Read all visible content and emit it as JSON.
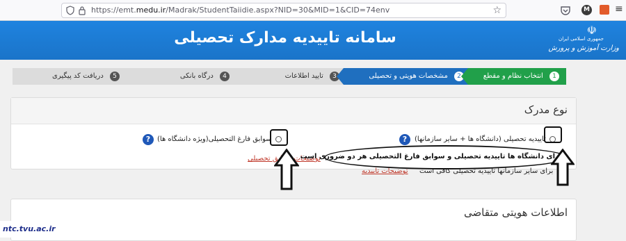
{
  "browser": {
    "url_prefix": "https://emt.",
    "url_domain": "medu.ir",
    "url_path": "/Madrak/StudentTaiidie.aspx?NID=30&MID=1&CID=74env",
    "profile_initial": "M"
  },
  "header": {
    "site_title": "سامانه تاییدیه مدارک تحصیلی",
    "logo_line1": "جمهوری اسلامی ایران",
    "logo_line2": "وزارت آموزش و پرورش",
    "color": "#1f83df"
  },
  "steps": [
    {
      "num": "1",
      "label": "انتخاب نظام و مقطع",
      "state": "done"
    },
    {
      "num": "2",
      "label": "مشخصات هویتی و تحصیلی",
      "state": "active"
    },
    {
      "num": "3",
      "label": "تایید اطلاعات",
      "state": "pending"
    },
    {
      "num": "4",
      "label": "درگاه بانکی",
      "state": "pending"
    },
    {
      "num": "5",
      "label": "دریافت کد پیگیری",
      "state": "pending"
    }
  ],
  "doc_type": {
    "title": "نوع مدرک",
    "option1": "تاییدیه تحصیلی (دانشگاه ها + سایر سازمانها)",
    "option2": "سوابق فارغ التحصیلی(ویژه دانشگاه ها)",
    "link_taiidie": "توضیحات تاییدیه",
    "link_savabegh": "توضیحات سوابق تحصیلی",
    "note_universities": "برای دانشگاه ها تاییدیه تحصیلی و سوابق فارغ التحصیلی هر دو ضروری است",
    "note_others": "برای سایر سازمانها تاییدیه تحصیلی کافی است",
    "help": "?"
  },
  "identity": {
    "title": "اطلاعات هویتی متقاضی"
  },
  "watermark": "ntc.tvu.ac.ir"
}
